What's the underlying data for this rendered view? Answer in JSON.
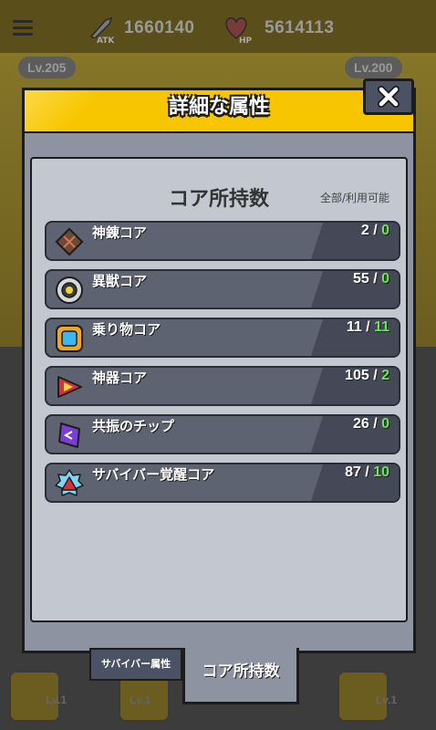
{
  "background": {
    "atk_label": "ATK",
    "atk_value": "1660140",
    "hp_label": "HP",
    "hp_value": "5614113",
    "left_level": "Lv.205",
    "right_level": "Lv.200",
    "bottom_levels": [
      "Lv.1",
      "Lv.1",
      "Lv.1"
    ]
  },
  "modal": {
    "title": "詳細な属性",
    "close_icon": "close-icon",
    "section_title": "コア所持数",
    "section_subtitle": "全部/利用可能",
    "items": [
      {
        "icon": "shinren-core-icon",
        "label": "神錬コア",
        "total": "2",
        "usable": "0"
      },
      {
        "icon": "beast-core-icon",
        "label": "異獣コア",
        "total": "55",
        "usable": "0"
      },
      {
        "icon": "vehicle-core-icon",
        "label": "乗り物コア",
        "total": "11",
        "usable": "11"
      },
      {
        "icon": "artifact-core-icon",
        "label": "神器コア",
        "total": "105",
        "usable": "2"
      },
      {
        "icon": "resonance-chip-icon",
        "label": "共振のチップ",
        "total": "26",
        "usable": "0"
      },
      {
        "icon": "survivor-awaken-core-icon",
        "label": "サバイバー覚醒コア",
        "total": "87",
        "usable": "10"
      }
    ],
    "tabs": [
      {
        "label": "サバイバー属性",
        "active": false
      },
      {
        "label": "コア所持数",
        "active": true
      }
    ]
  },
  "colors": {
    "header": "#f7c600",
    "panel": "#8d93a0",
    "row": "#5e6372",
    "usable": "#6de35a"
  }
}
